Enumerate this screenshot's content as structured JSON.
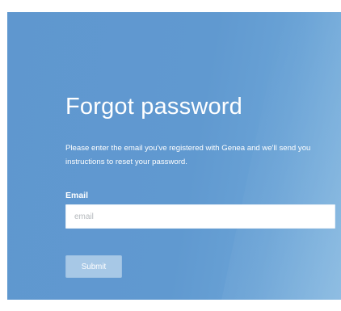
{
  "form": {
    "title": "Forgot password",
    "description": "Please enter the email you've registered with Genea and we'll send you instructions to reset your password.",
    "email_label": "Email",
    "email_placeholder": "email",
    "email_value": "",
    "submit_label": "Submit"
  },
  "colors": {
    "panel_background": "#6099d0",
    "button_background": "#a7c8e6",
    "text": "#ffffff"
  }
}
